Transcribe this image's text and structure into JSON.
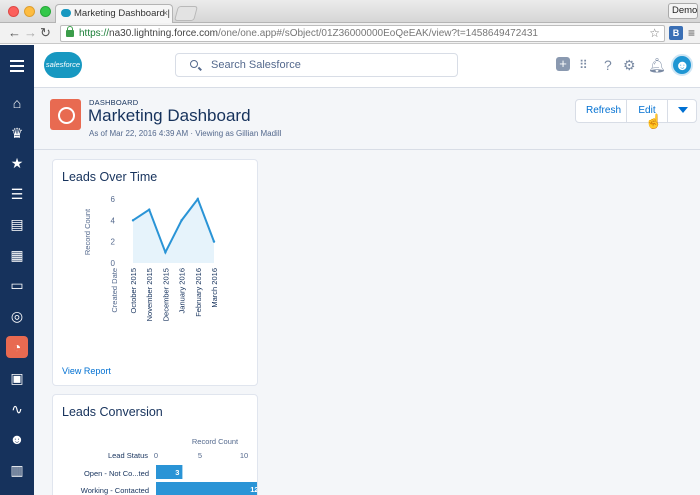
{
  "browser": {
    "tab_title": "Marketing Dashboard | Sal",
    "tab_close": "×",
    "url_scheme": "https://",
    "url_host": "na30.lightning.force.com",
    "url_path": "/one/one.app#/sObject/01Z36000000EoQeEAK/view?t=1458649472431",
    "profile_label": "Demo",
    "ext_label": "B"
  },
  "header": {
    "logo_text": "salesforce",
    "search_placeholder": "Search Salesforce"
  },
  "page": {
    "object_label": "DASHBOARD",
    "title": "Marketing Dashboard",
    "meta": "As of Mar 22, 2016 4:39 AM · Viewing as Gillian Madill",
    "buttons": {
      "refresh": "Refresh",
      "edit": "Edit"
    }
  },
  "cards": {
    "leads_over_time": {
      "title": "Leads Over Time",
      "view_report": "View Report"
    },
    "leads_conversion": {
      "title": "Leads Conversion"
    }
  },
  "colors": {
    "nav": "#16325c",
    "accent": "#0070d2",
    "dashboard_icon": "#e86a51",
    "chart_line": "#2a94d6",
    "chart_fill": "#e6f3fb",
    "bar": "#2a94d6"
  },
  "icons": [
    "menu-icon",
    "home-icon",
    "crown-icon",
    "star-icon",
    "task-list-icon",
    "files-icon",
    "building-icon",
    "contact-card-icon",
    "target-icon",
    "dashboard-icon",
    "clipboard-icon",
    "pulse-icon",
    "people-icon",
    "calendar-icon"
  ],
  "chart_data": [
    {
      "type": "area",
      "title": "Leads Over Time",
      "xlabel": "Created Date",
      "ylabel": "Record Count",
      "categories": [
        "October 2015",
        "November 2015",
        "December 2015",
        "January 2016",
        "February 2016",
        "March 2016"
      ],
      "values": [
        4,
        5,
        1,
        4,
        6,
        2
      ],
      "yticks": [
        "0",
        "2",
        "4",
        "6"
      ],
      "ylim": [
        0,
        6
      ]
    },
    {
      "type": "bar",
      "orientation": "horizontal",
      "title": "Leads Conversion",
      "category_label": "Lead Status",
      "value_label": "Record Count",
      "categories": [
        "Open - Not Co...ted",
        "Working - Contacted"
      ],
      "values": [
        3,
        12
      ],
      "xticks": [
        "0",
        "5",
        "10"
      ]
    }
  ]
}
